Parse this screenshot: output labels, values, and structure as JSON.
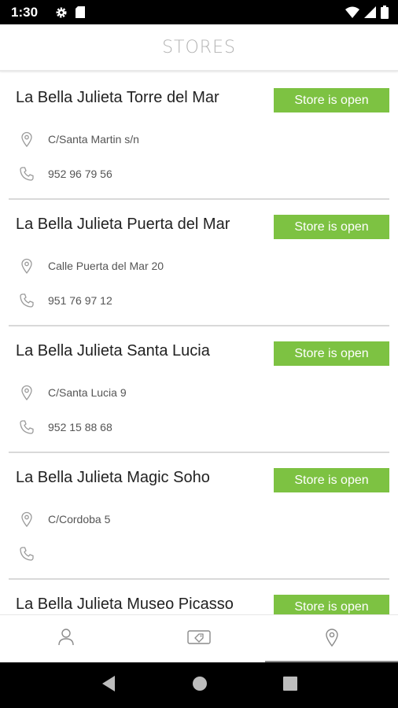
{
  "status_bar": {
    "time": "1:30",
    "icons": [
      "gear-icon",
      "sd-card-icon",
      "wifi-icon",
      "signal-icon",
      "battery-icon"
    ]
  },
  "header": {
    "title": "STORES"
  },
  "stores": [
    {
      "name": "La Bella Julieta Torre del Mar",
      "status": "Store is open",
      "address": "C/Santa Martin s/n",
      "phone": "952 96 79 56"
    },
    {
      "name": "La Bella Julieta Puerta del Mar",
      "status": "Store is open",
      "address": "Calle Puerta del Mar 20",
      "phone": "951 76 97 12"
    },
    {
      "name": "La Bella Julieta Santa Lucia",
      "status": "Store is open",
      "address": "C/Santa Lucia 9",
      "phone": "952 15 88 68"
    },
    {
      "name": "La Bella Julieta Magic Soho",
      "status": "Store is open",
      "address": "C/Cordoba 5",
      "phone": ""
    },
    {
      "name": "La Bella Julieta Museo Picasso",
      "status": "Store is open",
      "address": "",
      "phone": ""
    }
  ],
  "bottom_nav": {
    "tabs": [
      {
        "icon": "user-icon",
        "active": false
      },
      {
        "icon": "coupon-icon",
        "active": false
      },
      {
        "icon": "location-pin-icon",
        "active": true
      }
    ]
  },
  "colors": {
    "open_badge": "#7dc242",
    "title_grey": "#b3b3b3",
    "divider": "#d9d9d9"
  }
}
